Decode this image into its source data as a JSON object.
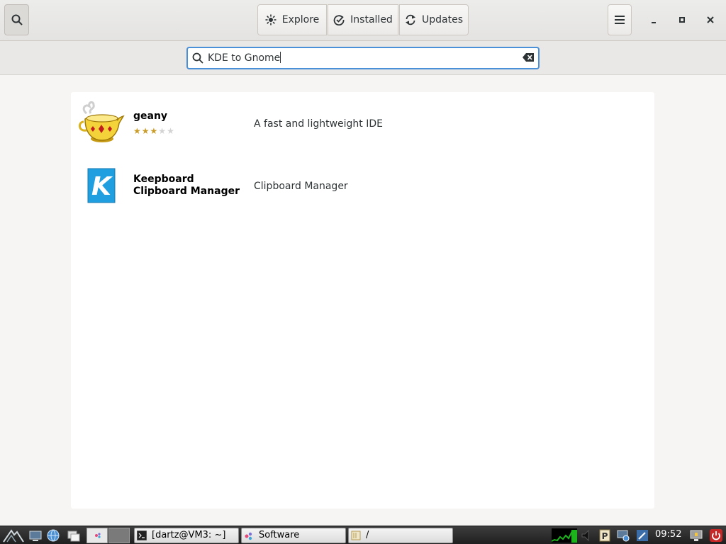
{
  "header": {
    "tabs": [
      {
        "label": "Explore",
        "icon": "explore-icon"
      },
      {
        "label": "Installed",
        "icon": "installed-icon"
      },
      {
        "label": "Updates",
        "icon": "updates-icon"
      }
    ],
    "search_toggle_icon": "search-icon",
    "menu_icon": "hamburger-menu-icon",
    "window_controls": [
      "minimize-icon",
      "maximize-icon",
      "close-icon"
    ]
  },
  "search": {
    "value": "KDE to Gnome",
    "icon": "search-icon",
    "clear_icon": "clear-text-icon"
  },
  "results": [
    {
      "name": "geany",
      "summary": "A fast and lightweight IDE",
      "rating": 3,
      "max_rating": 5,
      "icon": "geany-lamp-icon"
    },
    {
      "name_line1": "Keepboard",
      "name_line2": "Clipboard Manager",
      "summary": "Clipboard Manager",
      "icon": "keepboard-k-icon"
    }
  ],
  "taskbar": {
    "tasks": [
      {
        "label": "[dartz@VM3: ~]",
        "icon": "terminal-icon"
      },
      {
        "label": "Software",
        "icon": "software-icon"
      },
      {
        "label": "/",
        "icon": "folder-icon"
      }
    ],
    "clock": "09:52"
  },
  "colors": {
    "accent": "#4a90d9",
    "star": "#c99b27",
    "keepboard_blue": "#1f9fe0"
  }
}
